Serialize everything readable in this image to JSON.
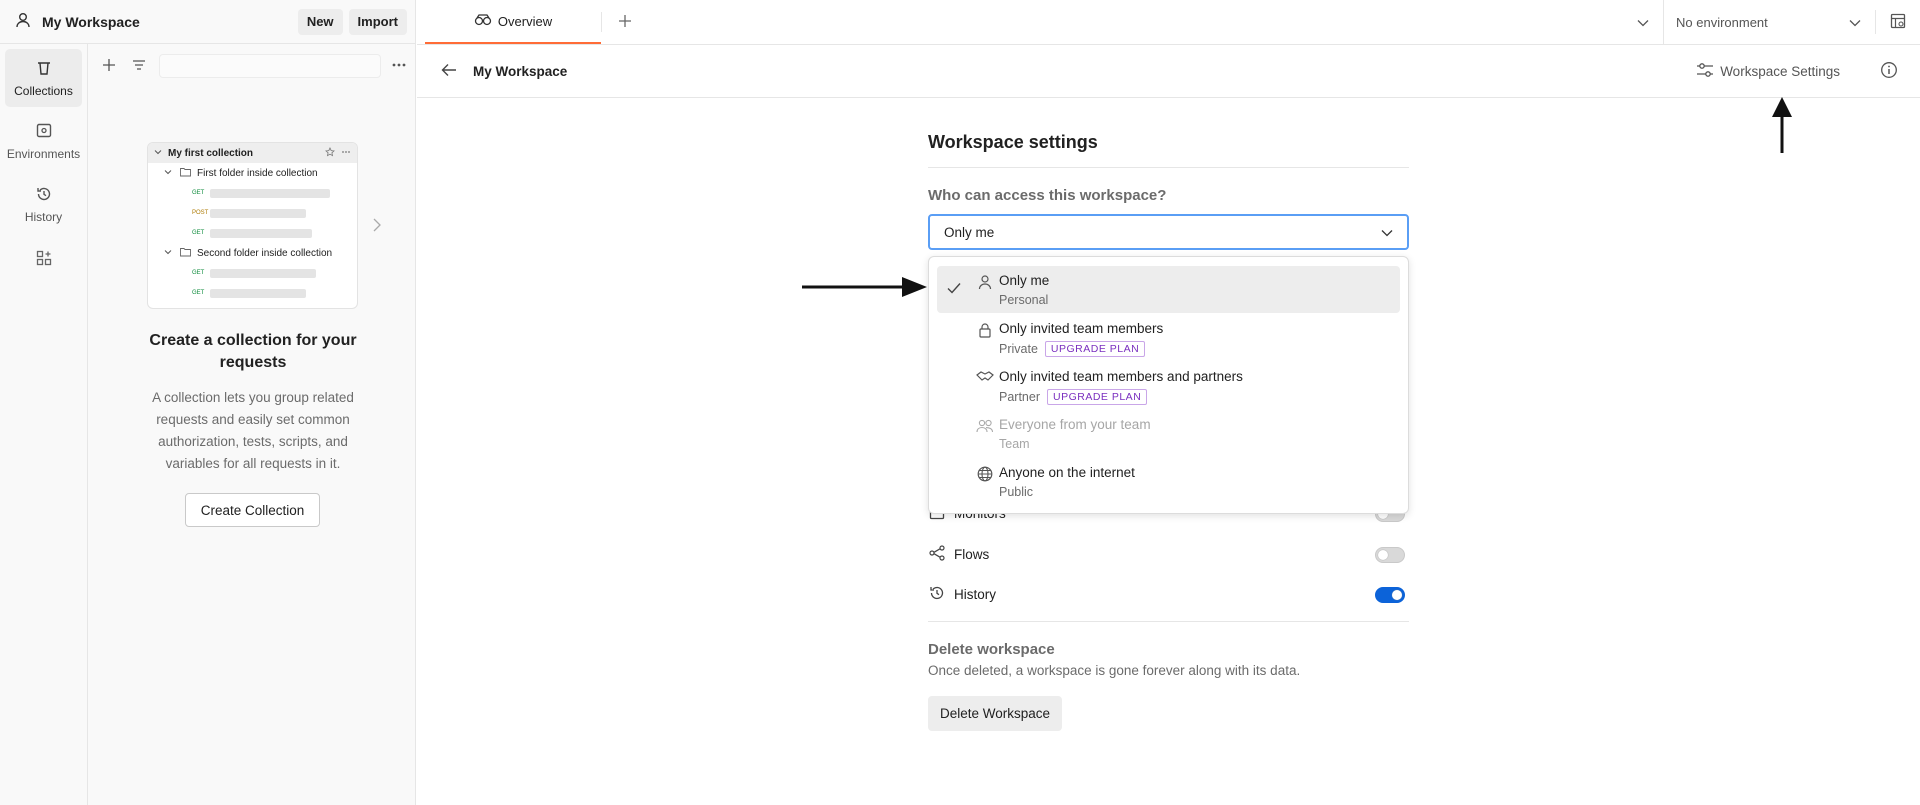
{
  "workspace": {
    "name": "My Workspace",
    "new_label": "New",
    "import_label": "Import"
  },
  "rail": {
    "items": [
      {
        "label": "Collections",
        "icon": "trash-can-icon"
      },
      {
        "label": "Environments",
        "icon": "environment-icon"
      },
      {
        "label": "History",
        "icon": "history-icon"
      }
    ]
  },
  "preview": {
    "collection": "My first collection",
    "folder1": "First folder inside collection",
    "folder2": "Second folder inside collection",
    "get": "GET",
    "post": "POST"
  },
  "empty_state": {
    "title": "Create a collection for your requests",
    "description": "A collection lets you group related requests and easily set common authorization, tests, scripts, and variables for all requests in it.",
    "button": "Create Collection"
  },
  "tabs": [
    {
      "label": "Overview"
    }
  ],
  "environment": {
    "selected": "No environment"
  },
  "subbar": {
    "title": "My Workspace",
    "settings_link": "Workspace Settings"
  },
  "settings": {
    "heading": "Workspace settings",
    "access_question": "Who can access this workspace?",
    "access_value": "Only me"
  },
  "access_options": [
    {
      "title": "Only me",
      "sub": "Personal",
      "icon": "person-icon",
      "selected": true
    },
    {
      "title": "Only invited team members",
      "sub": "Private",
      "badge": "UPGRADE PLAN",
      "icon": "lock-icon"
    },
    {
      "title": "Only invited team members and partners",
      "sub": "Partner",
      "badge": "UPGRADE PLAN",
      "icon": "handshake-icon"
    },
    {
      "title": "Everyone from your team",
      "sub": "Team",
      "icon": "team-icon",
      "disabled": true
    },
    {
      "title": "Anyone on the internet",
      "sub": "Public",
      "icon": "globe-icon"
    }
  ],
  "features": [
    {
      "label": "Monitors",
      "enabled": false
    },
    {
      "label": "Flows",
      "enabled": false
    },
    {
      "label": "History",
      "enabled": true
    }
  ],
  "delete": {
    "title": "Delete workspace",
    "description": "Once deleted, a workspace is gone forever along with its data.",
    "button": "Delete Workspace"
  },
  "colors": {
    "accent": "#ff6c37",
    "focus": "#5a9ef5",
    "toggle_on": "#0c63d9",
    "badge": "#7a2fbf"
  }
}
